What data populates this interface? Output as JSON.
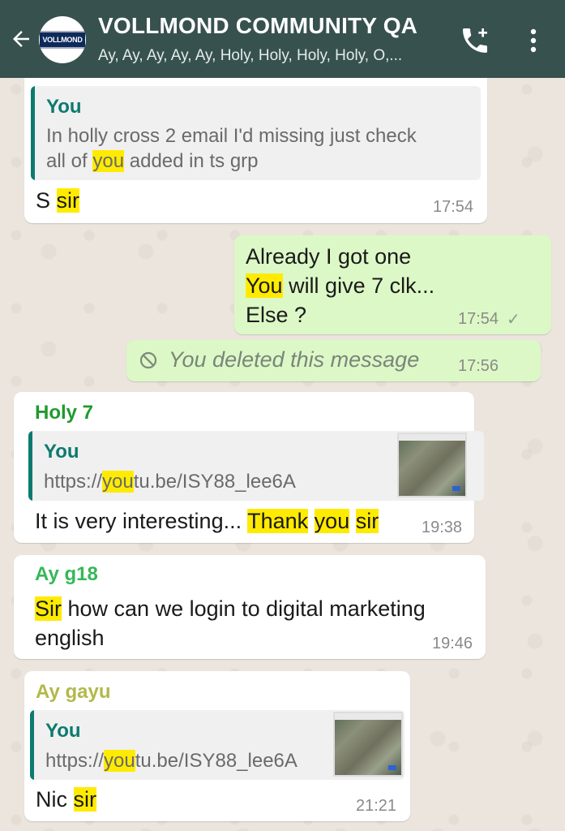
{
  "header": {
    "title": "VOLLMOND COMMUNITY QA",
    "subtitle": "Ay, Ay, Ay, Ay, Ay, Holy, Holy, Holy, Holy, O,...",
    "avatar_text": "VOLLMOND"
  },
  "messages": {
    "m1": {
      "quote_author": "You",
      "quote_line1_pre": "In holly cross 2 email I'd missing just check",
      "quote_line2_pre": "all of ",
      "quote_line2_hl": "you",
      "quote_line2_post": " added in ts grp",
      "text_pre": "S ",
      "text_hl": "sir",
      "time": "17:54"
    },
    "m2": {
      "line1": "Already I got one",
      "line2_hl": "You",
      "line2_post": " will give 7 clk...",
      "line3": "Else ?",
      "time": "17:54",
      "status": "✓"
    },
    "m3": {
      "text": "You deleted this message",
      "time": "17:56"
    },
    "m4": {
      "sender": "Holy 7",
      "sender_color": "#1f9b2c",
      "quote_author": "You",
      "quote_pre": "https://",
      "quote_hl": "you",
      "quote_post": "tu.be/ISY88_lee6A",
      "text_pre": "It is very interesting... ",
      "text_hl1": "Thank",
      "text_hl2": "you",
      "text_hl3": "sir",
      "time": "19:38"
    },
    "m5": {
      "sender": "Ay g18",
      "sender_color": "#35b85a",
      "line1_hl": "Sir",
      "line1_post": " how can we login to digital marketing",
      "line2": "english",
      "time": "19:46"
    },
    "m6": {
      "sender": "Ay gayu",
      "sender_color": "#b3b84a",
      "quote_author": "You",
      "quote_pre": "https://",
      "quote_hl": "you",
      "quote_post": "tu.be/ISY88_lee6A",
      "text_pre": "Nic ",
      "text_hl": "sir",
      "time": "21:21"
    }
  }
}
